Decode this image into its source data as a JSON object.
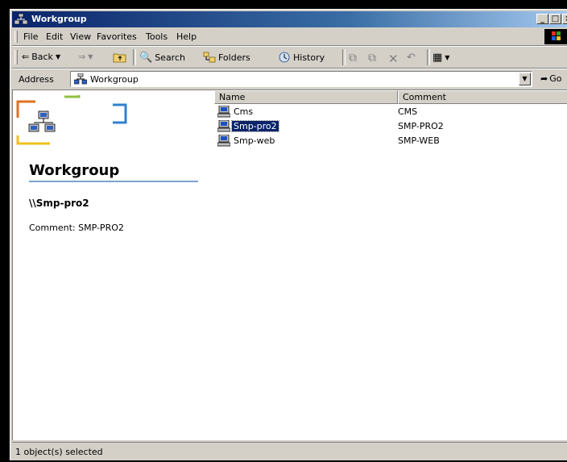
{
  "window": {
    "title": "Workgroup"
  },
  "menu": [
    "File",
    "Edit",
    "View",
    "Favorites",
    "Tools",
    "Help"
  ],
  "toolbar": {
    "back": "Back",
    "search": "Search",
    "folders": "Folders",
    "history": "History"
  },
  "address": {
    "label": "Address",
    "value": "Workgroup",
    "go": "Go"
  },
  "left_pane": {
    "title": "Workgroup",
    "selected_name": "\\\\Smp-pro2",
    "selected_comment": "Comment: SMP-PRO2"
  },
  "list": {
    "columns": [
      "Name",
      "Comment"
    ],
    "rows": [
      {
        "name": "Cms",
        "comment": "CMS",
        "selected": false
      },
      {
        "name": "Smp-pro2",
        "comment": "SMP-PRO2",
        "selected": true
      },
      {
        "name": "Smp-web",
        "comment": "SMP-WEB",
        "selected": false
      }
    ]
  },
  "status": {
    "text": "1 object(s) selected"
  },
  "colors": {
    "title_bar": "#0a246a",
    "selection": "#0a246a",
    "face": "#d4d0c8"
  }
}
